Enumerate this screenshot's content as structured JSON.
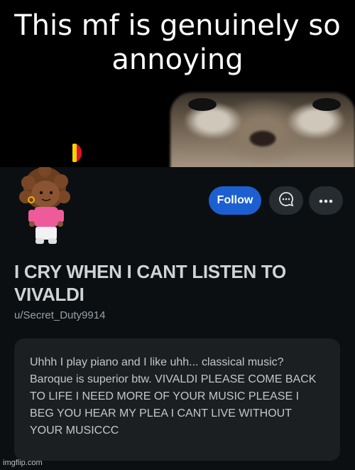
{
  "meme": {
    "caption": "This mf is genuinely so annoying"
  },
  "profile": {
    "flag_colors": [
      "#000000",
      "#f6d300",
      "#e3102a"
    ],
    "follow_label": "Follow",
    "chat_icon": "chat-bubble-icon",
    "more_icon": "more-horizontal-icon",
    "display_name": "I CRY WHEN I CANT LISTEN TO VIVALDI",
    "username": "u/Secret_Duty9914",
    "bio": "Uhhh I play piano and I like uhh... classical music? Baroque is superior btw. VIVALDI PLEASE COME BACK TO LIFE I NEED MORE OF YOUR MUSIC PLEASE I BEG YOU HEAR MY PLEA I CANT LIVE WITHOUT YOUR MUSICCC",
    "follow_color": "#1c5fd0"
  },
  "watermark": "imgflip.com"
}
